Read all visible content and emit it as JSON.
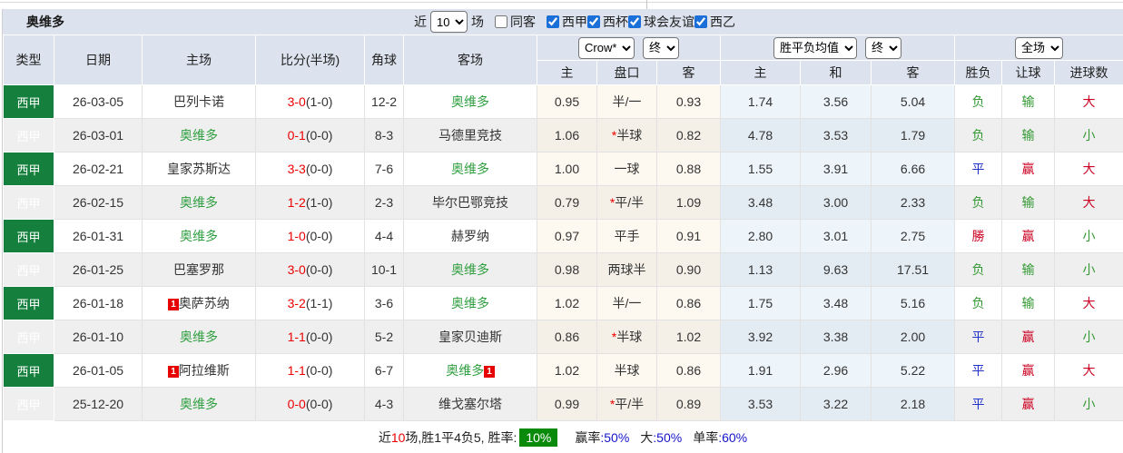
{
  "title": "奥维多",
  "toolbar": {
    "recent_label": "近",
    "matches_count": "10",
    "matches_label": "场",
    "same_away_label": "同客",
    "same_away_checked": false,
    "filters": [
      {
        "label": "西甲",
        "checked": true
      },
      {
        "label": "西杯",
        "checked": true
      },
      {
        "label": "球会友谊",
        "checked": true
      },
      {
        "label": "西乙",
        "checked": true
      }
    ]
  },
  "header": {
    "col_type": "类型",
    "col_date": "日期",
    "col_home": "主场",
    "col_score": "比分(半场)",
    "col_corner": "角球",
    "col_away": "客场",
    "select_bookmaker": "Crow*",
    "select_bookmaker_time": "终",
    "select_avg": "胜平负均值",
    "select_avg_time": "终",
    "select_scope": "全场",
    "sub_home": "主",
    "sub_handicap": "盘口",
    "sub_away": "客",
    "sub_avg_home": "主",
    "sub_avg_draw": "和",
    "sub_avg_away": "客",
    "sub_result": "胜负",
    "sub_handicap_result": "让球",
    "sub_goals": "进球数"
  },
  "rows": [
    {
      "league": "西甲",
      "date": "26-03-05",
      "home": "巴列卡诺",
      "home_focus": false,
      "home_badge": "",
      "score": "3-0",
      "half": "(1-0)",
      "corner": "12-2",
      "away": "奥维多",
      "away_focus": true,
      "away_badge": "",
      "odds_home": "0.95",
      "handicap_star": "",
      "handicap": "半/一",
      "odds_away": "0.93",
      "avg_home": "1.74",
      "avg_draw": "3.56",
      "avg_away": "5.04",
      "result": "负",
      "result_color": "green",
      "spread": "输",
      "spread_color": "green",
      "goals": "大",
      "goals_color": "red"
    },
    {
      "league": "西甲",
      "date": "26-03-01",
      "home": "奥维多",
      "home_focus": true,
      "home_badge": "",
      "score": "0-1",
      "half": "(0-0)",
      "corner": "8-3",
      "away": "马德里竞技",
      "away_focus": false,
      "away_badge": "",
      "odds_home": "1.06",
      "handicap_star": "*",
      "handicap": "半球",
      "odds_away": "0.82",
      "avg_home": "4.78",
      "avg_draw": "3.53",
      "avg_away": "1.79",
      "result": "负",
      "result_color": "green",
      "spread": "输",
      "spread_color": "green",
      "goals": "小",
      "goals_color": "green"
    },
    {
      "league": "西甲",
      "date": "26-02-21",
      "home": "皇家苏斯达",
      "home_focus": false,
      "home_badge": "",
      "score": "3-3",
      "half": "(0-0)",
      "corner": "7-6",
      "away": "奥维多",
      "away_focus": true,
      "away_badge": "",
      "odds_home": "1.00",
      "handicap_star": "",
      "handicap": "一球",
      "odds_away": "0.88",
      "avg_home": "1.55",
      "avg_draw": "3.91",
      "avg_away": "6.66",
      "result": "平",
      "result_color": "blue",
      "spread": "赢",
      "spread_color": "red",
      "goals": "大",
      "goals_color": "red"
    },
    {
      "league": "西甲",
      "date": "26-02-15",
      "home": "奥维多",
      "home_focus": true,
      "home_badge": "",
      "score": "1-2",
      "half": "(1-0)",
      "corner": "2-3",
      "away": "毕尔巴鄂竞技",
      "away_focus": false,
      "away_badge": "",
      "odds_home": "0.79",
      "handicap_star": "*",
      "handicap": "平/半",
      "odds_away": "1.09",
      "avg_home": "3.48",
      "avg_draw": "3.00",
      "avg_away": "2.33",
      "result": "负",
      "result_color": "green",
      "spread": "输",
      "spread_color": "green",
      "goals": "大",
      "goals_color": "red"
    },
    {
      "league": "西甲",
      "date": "26-01-31",
      "home": "奥维多",
      "home_focus": true,
      "home_badge": "",
      "score": "1-0",
      "half": "(0-0)",
      "corner": "4-4",
      "away": "赫罗纳",
      "away_focus": false,
      "away_badge": "",
      "odds_home": "0.97",
      "handicap_star": "",
      "handicap": "平手",
      "odds_away": "0.91",
      "avg_home": "2.80",
      "avg_draw": "3.01",
      "avg_away": "2.75",
      "result": "勝",
      "result_color": "red",
      "spread": "赢",
      "spread_color": "red",
      "goals": "小",
      "goals_color": "green"
    },
    {
      "league": "西甲",
      "date": "26-01-25",
      "home": "巴塞罗那",
      "home_focus": false,
      "home_badge": "",
      "score": "3-0",
      "half": "(0-0)",
      "corner": "10-1",
      "away": "奥维多",
      "away_focus": true,
      "away_badge": "",
      "odds_home": "0.98",
      "handicap_star": "",
      "handicap": "两球半",
      "odds_away": "0.90",
      "avg_home": "1.13",
      "avg_draw": "9.63",
      "avg_away": "17.51",
      "result": "负",
      "result_color": "green",
      "spread": "输",
      "spread_color": "green",
      "goals": "小",
      "goals_color": "green"
    },
    {
      "league": "西甲",
      "date": "26-01-18",
      "home": "奥萨苏纳",
      "home_focus": false,
      "home_badge": "1",
      "score": "3-2",
      "half": "(1-1)",
      "corner": "3-6",
      "away": "奥维多",
      "away_focus": true,
      "away_badge": "",
      "odds_home": "1.02",
      "handicap_star": "",
      "handicap": "半/一",
      "odds_away": "0.86",
      "avg_home": "1.75",
      "avg_draw": "3.48",
      "avg_away": "5.16",
      "result": "负",
      "result_color": "green",
      "spread": "输",
      "spread_color": "green",
      "goals": "大",
      "goals_color": "red"
    },
    {
      "league": "西甲",
      "date": "26-01-10",
      "home": "奥维多",
      "home_focus": true,
      "home_badge": "",
      "score": "1-1",
      "half": "(0-0)",
      "corner": "5-2",
      "away": "皇家贝迪斯",
      "away_focus": false,
      "away_badge": "",
      "odds_home": "0.86",
      "handicap_star": "*",
      "handicap": "半球",
      "odds_away": "1.02",
      "avg_home": "3.92",
      "avg_draw": "3.38",
      "avg_away": "2.00",
      "result": "平",
      "result_color": "blue",
      "spread": "赢",
      "spread_color": "red",
      "goals": "小",
      "goals_color": "green"
    },
    {
      "league": "西甲",
      "date": "26-01-05",
      "home": "阿拉维斯",
      "home_focus": false,
      "home_badge": "1",
      "score": "1-1",
      "half": "(0-0)",
      "corner": "6-7",
      "away": "奥维多",
      "away_focus": true,
      "away_badge": "1",
      "odds_home": "1.02",
      "handicap_star": "",
      "handicap": "半球",
      "odds_away": "0.86",
      "avg_home": "1.91",
      "avg_draw": "2.96",
      "avg_away": "5.22",
      "result": "平",
      "result_color": "blue",
      "spread": "赢",
      "spread_color": "red",
      "goals": "大",
      "goals_color": "red"
    },
    {
      "league": "西甲",
      "date": "25-12-20",
      "home": "奥维多",
      "home_focus": true,
      "home_badge": "",
      "score": "0-0",
      "half": "(0-0)",
      "corner": "4-3",
      "away": "维戈塞尔塔",
      "away_focus": false,
      "away_badge": "",
      "odds_home": "0.99",
      "handicap_star": "*",
      "handicap": "平/半",
      "odds_away": "0.89",
      "avg_home": "3.53",
      "avg_draw": "3.22",
      "avg_away": "2.18",
      "result": "平",
      "result_color": "blue",
      "spread": "赢",
      "spread_color": "red",
      "goals": "小",
      "goals_color": "green"
    }
  ],
  "footer": {
    "prefix": "近",
    "count": "10",
    "summary": "场,胜1平4负5, 胜率:",
    "rate_badge": "10%",
    "stats": [
      {
        "label": "赢率",
        "value": ":50%"
      },
      {
        "label": "大",
        "value": ":50%"
      },
      {
        "label": "单率",
        "value": ":60%"
      }
    ]
  },
  "colors": {
    "header_bg": "#dce3ee",
    "league_green": "#15803d",
    "focus_team_green": "#2f9e3f",
    "score_red": "#ee0000",
    "win_red": "#cc0022",
    "draw_blue": "#2233cc",
    "lose_green": "#339933",
    "rate_badge_green": "#0a8a0a",
    "stat_value_blue": "#1515cc",
    "crow_col_bg": "#fdf9f0",
    "avg_col_bg": "#edf4fa"
  }
}
